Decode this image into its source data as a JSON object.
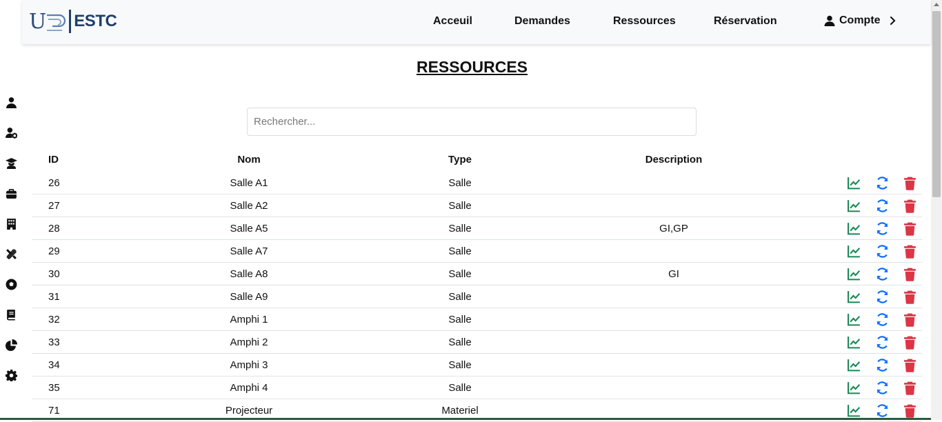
{
  "navbar": {
    "logo_left": "U",
    "logo_text": "ESTC",
    "links": [
      "Acceuil",
      "Demandes",
      "Ressources",
      "Réservation"
    ],
    "account": "Compte"
  },
  "sidebar": {
    "icons": [
      "user-icon",
      "user-gear-icon",
      "graduate-icon",
      "briefcase-icon",
      "building-icon",
      "tools-icon",
      "soccer-ball-icon",
      "book-icon",
      "pie-chart-icon",
      "gear-icon"
    ]
  },
  "page": {
    "title": "RESSOURCES",
    "search_placeholder": "Rechercher..."
  },
  "table": {
    "headers": [
      "ID",
      "Nom",
      "Type",
      "Description"
    ],
    "rows": [
      {
        "id": "26",
        "nom": "Salle A1",
        "type": "Salle",
        "description": ""
      },
      {
        "id": "27",
        "nom": "Salle A2",
        "type": "Salle",
        "description": ""
      },
      {
        "id": "28",
        "nom": "Salle A5",
        "type": "Salle",
        "description": "GI,GP"
      },
      {
        "id": "29",
        "nom": "Salle A7",
        "type": "Salle",
        "description": ""
      },
      {
        "id": "30",
        "nom": "Salle A8",
        "type": "Salle",
        "description": "GI"
      },
      {
        "id": "31",
        "nom": "Salle A9",
        "type": "Salle",
        "description": ""
      },
      {
        "id": "32",
        "nom": "Amphi 1",
        "type": "Salle",
        "description": ""
      },
      {
        "id": "33",
        "nom": "Amphi 2",
        "type": "Salle",
        "description": ""
      },
      {
        "id": "34",
        "nom": "Amphi 3",
        "type": "Salle",
        "description": ""
      },
      {
        "id": "35",
        "nom": "Amphi 4",
        "type": "Salle",
        "description": ""
      },
      {
        "id": "71",
        "nom": "Projecteur",
        "type": "Materiel",
        "description": ""
      }
    ]
  },
  "colors": {
    "stats": "#198754",
    "update": "#0d6efd",
    "delete": "#dc3545"
  }
}
